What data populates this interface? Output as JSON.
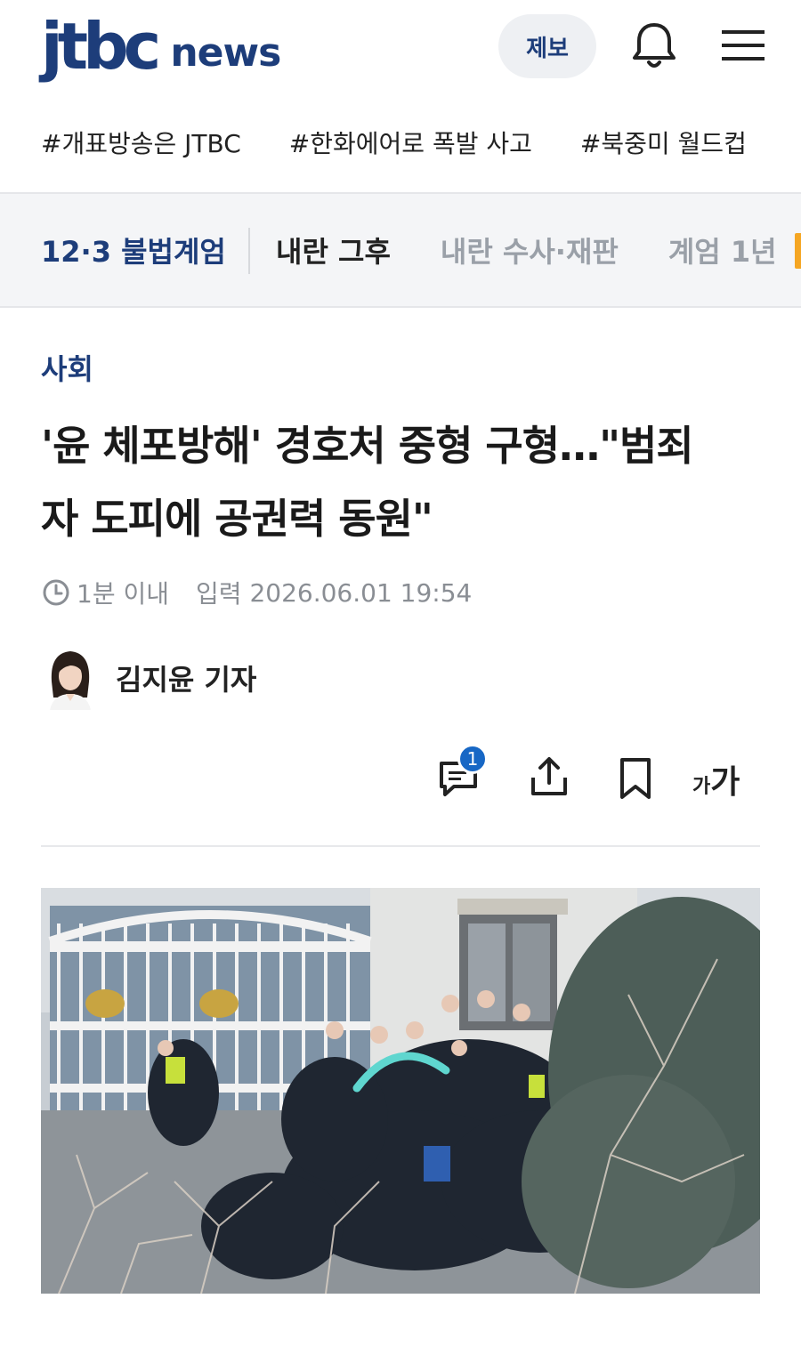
{
  "header": {
    "logo_main": "jtbc",
    "logo_sub": "news",
    "tip_label": "제보",
    "icons": [
      "bell-icon",
      "menu-icon"
    ]
  },
  "hashtags": [
    "#개표방송은 JTBC",
    "#한화에어로 폭발 사고",
    "#북중미 월드컵"
  ],
  "issue_bar": {
    "main": "12·3 불법계엄",
    "items": [
      "내란 그후",
      "내란 수사·재판",
      "계엄 1년"
    ]
  },
  "article": {
    "category": "사회",
    "title_line1": "'윤 체포방해' 경호처 중형 구형…\"범죄",
    "title_line2": "자 도피에 공권력 동원\"",
    "ago": "1분 이내",
    "input_label": "입력",
    "input_datetime": "2026.06.01 19:54",
    "author": "김지윤 기자"
  },
  "tools": {
    "comment_count": "1",
    "font_small": "가",
    "font_big": "가",
    "icons": [
      "comment-icon",
      "share-icon",
      "bookmark-icon",
      "font-size-icon"
    ]
  },
  "colors": {
    "brand": "#1d3d7a",
    "badge": "#1767c5",
    "accent": "#f5a623",
    "muted": "#9aa0a8"
  }
}
